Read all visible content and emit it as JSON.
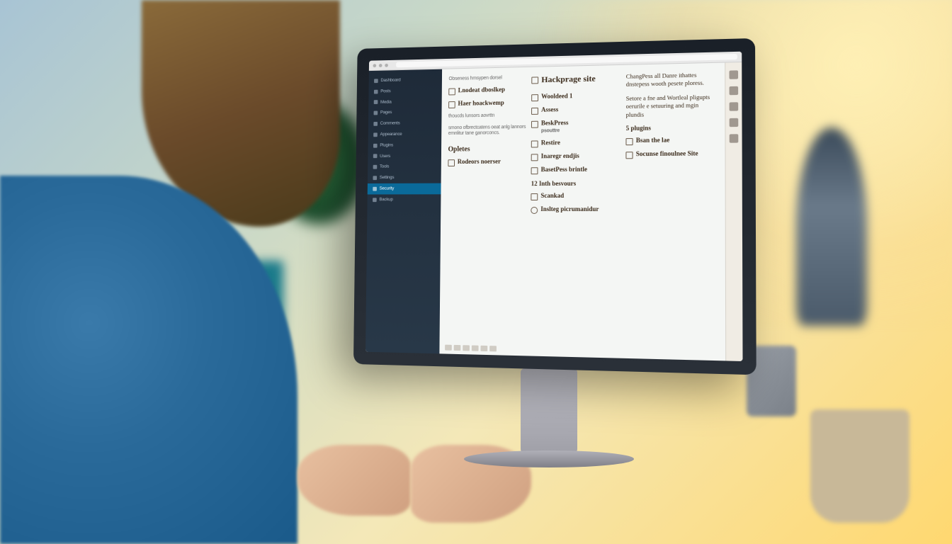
{
  "sidebar": {
    "items": [
      {
        "label": "Dashboard"
      },
      {
        "label": "Posts"
      },
      {
        "label": "Media"
      },
      {
        "label": "Pages"
      },
      {
        "label": "Comments"
      },
      {
        "label": "Appearance"
      },
      {
        "label": "Plugins"
      },
      {
        "label": "Users"
      },
      {
        "label": "Tools"
      },
      {
        "label": "Settings"
      },
      {
        "label": "Security"
      },
      {
        "label": "Backup"
      }
    ]
  },
  "col1": {
    "note1": "Obseness hmsypen dorsel",
    "item1": "Lnodeat dboslkep",
    "item2": "Haer hoackwemp",
    "small1": "thoucds lunsors aovrttn",
    "small2": "smono ofbrectcatens oeat anlg lannors emnlitur tane ganorconcs.",
    "heading": "Opletes",
    "item3": "Rodeors noerser"
  },
  "col2": {
    "title": "Hackprage site",
    "item1": "Wooldeed 1",
    "item2": "Assess",
    "item3": "BeskPress",
    "item3b": "psouttre",
    "item4": "Restire",
    "item5": "Inaregr endjis",
    "item6": "BasetPess brintle",
    "stat1": "12 Inth besvours",
    "item7": "Scankad",
    "item8": "Inslteg picrumanidur"
  },
  "col3": {
    "para1": "ChangPess all Danre ithattes dnstepess wooth pesete ploress.",
    "para2": "Setore a fne and Wortleal pligupts oerurile e setuuring and mgin plundis",
    "stat": "5 plugins",
    "item1": "Bsan the lae",
    "item2": "Socunse finoulnee Site"
  }
}
